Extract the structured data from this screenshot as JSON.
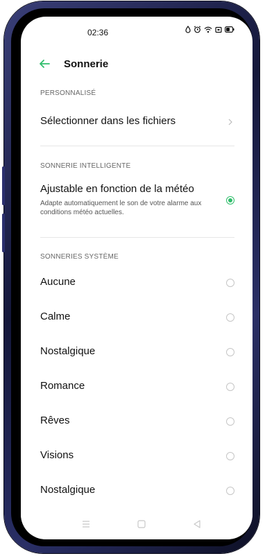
{
  "status_bar": {
    "time": "02:36",
    "icons": [
      "drop-icon",
      "alarm-icon",
      "wifi-icon",
      "notification-icon",
      "battery-icon"
    ]
  },
  "header": {
    "back_icon": "arrow-left-icon",
    "title": "Sonnerie"
  },
  "sections": {
    "custom": {
      "header": "PERSONNALISÉ",
      "item_label": "Sélectionner dans les fichiers"
    },
    "smart": {
      "header": "SONNERIE INTELLIGENTE",
      "item_label": "Ajustable en fonction de la météo",
      "item_desc": "Adapte automatiquement le son de votre alarme aux conditions météo actuelles.",
      "selected": true
    },
    "system": {
      "header": "SONNERIES SYSTÈME",
      "items": [
        {
          "label": "Aucune",
          "selected": false
        },
        {
          "label": "Calme",
          "selected": false
        },
        {
          "label": "Nostalgique",
          "selected": false
        },
        {
          "label": "Romance",
          "selected": false
        },
        {
          "label": "Rêves",
          "selected": false
        },
        {
          "label": "Visions",
          "selected": false
        },
        {
          "label": "Nostalgique",
          "selected": false
        }
      ]
    }
  },
  "navigation_bar": {
    "icons": [
      "menu-icon",
      "home-icon",
      "back-triangle-icon"
    ]
  },
  "colors": {
    "accent": "#2fbd6b",
    "frame": "#1c1f4a"
  }
}
